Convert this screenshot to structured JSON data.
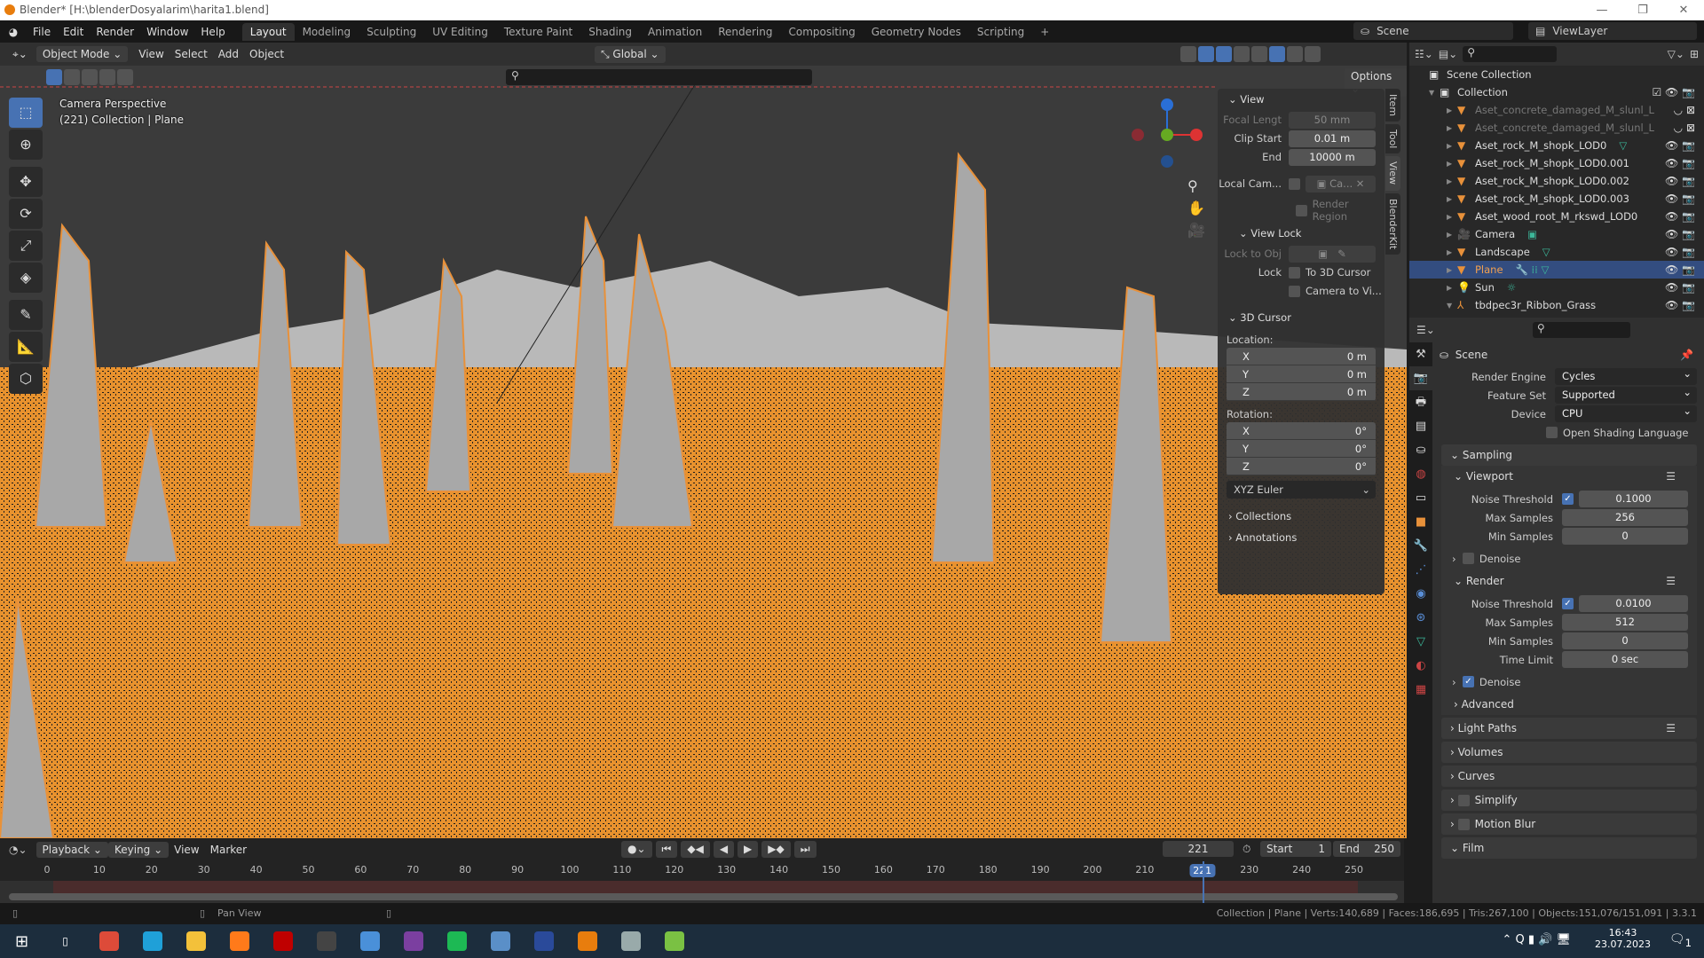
{
  "window": {
    "title": "Blender* [H:\\blenderDosyalarim\\harita1.blend]",
    "minimize": "—",
    "maximize": "❐",
    "close": "✕"
  },
  "menu": [
    "File",
    "Edit",
    "Render",
    "Window",
    "Help"
  ],
  "workspaces": [
    {
      "label": "Layout",
      "active": true
    },
    {
      "label": "Modeling"
    },
    {
      "label": "Sculpting"
    },
    {
      "label": "UV Editing"
    },
    {
      "label": "Texture Paint"
    },
    {
      "label": "Shading"
    },
    {
      "label": "Animation"
    },
    {
      "label": "Rendering"
    },
    {
      "label": "Compositing"
    },
    {
      "label": "Geometry Nodes"
    },
    {
      "label": "Scripting"
    }
  ],
  "add_workspace": "+",
  "scene": {
    "name": "Scene",
    "view_layer": "ViewLayer"
  },
  "header": {
    "mode": "Object Mode",
    "menus": [
      "View",
      "Select",
      "Add",
      "Object"
    ],
    "orientation": "Global",
    "options": "Options"
  },
  "viewport": {
    "camera_label": "Camera Perspective",
    "object_label": "(221) Collection | Plane",
    "accent": "#e8913a"
  },
  "tools": [
    {
      "icon": "select-box-icon",
      "glyph": "⬚",
      "active": true
    },
    {
      "icon": "cursor-icon",
      "glyph": "⊕"
    },
    {
      "icon": "move-icon",
      "glyph": "✥"
    },
    {
      "icon": "rotate-icon",
      "glyph": "⟳"
    },
    {
      "icon": "scale-icon",
      "glyph": "⤢"
    },
    {
      "icon": "transform-icon",
      "glyph": "◈"
    },
    {
      "icon": "annotate-icon",
      "glyph": "✎"
    },
    {
      "icon": "measure-icon",
      "glyph": "📐"
    },
    {
      "icon": "add-cube-icon",
      "glyph": "⬡"
    }
  ],
  "npanel": {
    "tabs": [
      "Item",
      "Tool",
      "View",
      "BlenderKit"
    ],
    "active_tab": "View",
    "view": {
      "title": "View",
      "focal_label": "Focal Lengt",
      "focal": "50 mm",
      "clip_start_label": "Clip Start",
      "clip_start": "0.01 m",
      "end_label": "End",
      "end": "10000 m",
      "local_cam_label": "Local Cam...",
      "local_cam_value": "Ca...",
      "render_region": "Render Region"
    },
    "view_lock": {
      "title": "View Lock",
      "lock_obj_label": "Lock to Obj",
      "lock_label": "Lock",
      "to_cursor": "To 3D Cursor",
      "camera_to_view": "Camera to Vi..."
    },
    "cursor": {
      "title": "3D Cursor",
      "location_label": "Location:",
      "loc": [
        {
          "axis": "X",
          "value": "0 m"
        },
        {
          "axis": "Y",
          "value": "0 m"
        },
        {
          "axis": "Z",
          "value": "0 m"
        }
      ],
      "rotation_label": "Rotation:",
      "rot": [
        {
          "axis": "X",
          "value": "0°"
        },
        {
          "axis": "Y",
          "value": "0°"
        },
        {
          "axis": "Z",
          "value": "0°"
        }
      ],
      "mode": "XYZ Euler"
    },
    "collections": "Collections",
    "annotations": "Annotations"
  },
  "outliner": {
    "root": "Scene Collection",
    "items": [
      {
        "name": "Collection",
        "icon": "collection-icon",
        "glyph": "▣",
        "expanded": true,
        "level": 0,
        "right": "☑ 👁 📷"
      },
      {
        "name": "Aset_concrete_damaged_M_slunl_L",
        "icon": "mesh-icon",
        "glyph": "▼",
        "level": 1,
        "dim": true,
        "right": "◡ ⊠"
      },
      {
        "name": "Aset_concrete_damaged_M_slunl_L",
        "icon": "mesh-icon",
        "glyph": "▼",
        "level": 1,
        "dim": true,
        "right": "◡ ⊠"
      },
      {
        "name": "Aset_rock_M_shopk_LOD0",
        "icon": "mesh-icon",
        "glyph": "▼",
        "level": 1,
        "extra": "▽",
        "right": "👁 📷"
      },
      {
        "name": "Aset_rock_M_shopk_LOD0.001",
        "icon": "mesh-icon",
        "glyph": "▼",
        "level": 1,
        "right": "👁 📷"
      },
      {
        "name": "Aset_rock_M_shopk_LOD0.002",
        "icon": "mesh-icon",
        "glyph": "▼",
        "level": 1,
        "right": "👁 📷"
      },
      {
        "name": "Aset_rock_M_shopk_LOD0.003",
        "icon": "mesh-icon",
        "glyph": "▼",
        "level": 1,
        "right": "👁 📷"
      },
      {
        "name": "Aset_wood_root_M_rkswd_LOD0",
        "icon": "mesh-icon",
        "glyph": "▼",
        "level": 1,
        "right": "👁 📷"
      },
      {
        "name": "Camera",
        "icon": "camera-icon",
        "glyph": "🎥",
        "level": 1,
        "extra": "▣",
        "right": "👁 📷"
      },
      {
        "name": "Landscape",
        "icon": "mesh-icon",
        "glyph": "▼",
        "level": 1,
        "extra": "▽",
        "right": "👁 📷"
      },
      {
        "name": "Plane",
        "icon": "mesh-icon",
        "glyph": "▼",
        "level": 1,
        "selected": true,
        "extra": "🔧 ⁞⁞ ▽",
        "right": "👁 📷"
      },
      {
        "name": "Sun",
        "icon": "light-icon",
        "glyph": "💡",
        "level": 1,
        "extra": "☼",
        "right": "👁 📷"
      },
      {
        "name": "tbdpec3r_Ribbon_Grass",
        "icon": "empty-icon",
        "glyph": "⅄",
        "level": 1,
        "expanded": true,
        "right": "👁 📷"
      }
    ]
  },
  "properties": {
    "context": "Scene",
    "render_engine_label": "Render Engine",
    "render_engine": "Cycles",
    "feature_set_label": "Feature Set",
    "feature_set": "Supported",
    "device_label": "Device",
    "device": "CPU",
    "osl": "Open Shading Language",
    "sampling": "Sampling",
    "viewport": {
      "title": "Viewport",
      "noise_label": "Noise Threshold",
      "noise": "0.1000",
      "noise_on": true,
      "max_label": "Max Samples",
      "max": "256",
      "min_label": "Min Samples",
      "min": "0",
      "denoise": "Denoise",
      "denoise_on": false
    },
    "render": {
      "title": "Render",
      "noise_label": "Noise Threshold",
      "noise": "0.0100",
      "noise_on": true,
      "max_label": "Max Samples",
      "max": "512",
      "min_label": "Min Samples",
      "min": "0",
      "time_label": "Time Limit",
      "time": "0 sec",
      "denoise": "Denoise",
      "denoise_on": true
    },
    "advanced": "Advanced",
    "panels": [
      {
        "label": "Light Paths",
        "list": true
      },
      {
        "label": "Volumes"
      },
      {
        "label": "Curves"
      },
      {
        "label": "Simplify",
        "checkbox": true
      },
      {
        "label": "Motion Blur",
        "checkbox": true
      },
      {
        "label": "Film",
        "open": true
      }
    ]
  },
  "timeline": {
    "menus": [
      "Playback",
      "Keying",
      "View",
      "Marker"
    ],
    "current_frame": "221",
    "start_label": "Start",
    "start": "1",
    "end_label": "End",
    "end": "250",
    "ticks": [
      0,
      10,
      20,
      30,
      40,
      50,
      60,
      70,
      80,
      90,
      100,
      110,
      120,
      130,
      140,
      150,
      160,
      170,
      180,
      190,
      200,
      210,
      221,
      230,
      240,
      250
    ]
  },
  "status": {
    "hint": "Pan View",
    "stats": "Collection | Plane | Verts:140,689 | Faces:186,695 | Tris:267,100 | Objects:151,076/151,091 | 3.3.1"
  },
  "taskbar": {
    "apps": [
      {
        "name": "chrome",
        "color": "#dd4b39"
      },
      {
        "name": "edge",
        "color": "#1fa0d8"
      },
      {
        "name": "file-explorer",
        "color": "#f3c13a"
      },
      {
        "name": "firefox",
        "color": "#ff7a1a"
      },
      {
        "name": "filezilla",
        "color": "#bf0000"
      },
      {
        "name": "mixer",
        "color": "#444"
      },
      {
        "name": "control-panel",
        "color": "#4a90d9"
      },
      {
        "name": "winrar",
        "color": "#7b3fa0"
      },
      {
        "name": "spotify",
        "color": "#1db954"
      },
      {
        "name": "network",
        "color": "#5a8fc8"
      },
      {
        "name": "quill",
        "color": "#2a4a9a"
      },
      {
        "name": "blender",
        "color": "#e87d0d"
      },
      {
        "name": "resource-monitor",
        "color": "#9aa"
      },
      {
        "name": "notepad",
        "color": "#7ac143"
      }
    ],
    "time": "16:43",
    "date": "23.07.2023",
    "notifications": "1"
  }
}
